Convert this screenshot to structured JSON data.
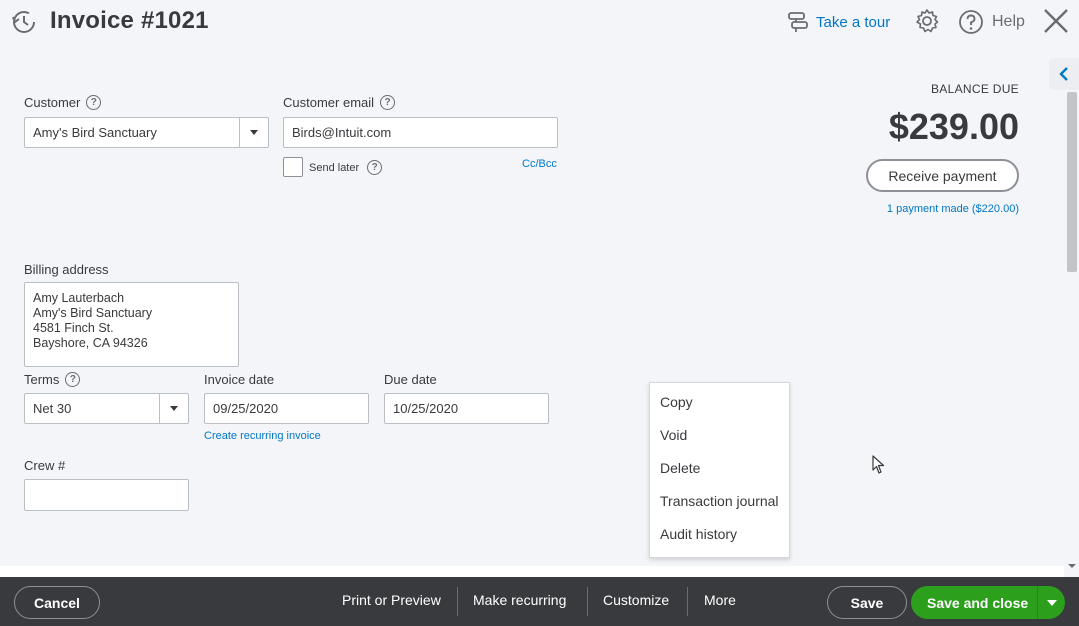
{
  "header": {
    "title": "Invoice #1021",
    "take_tour": "Take a tour",
    "help": "Help"
  },
  "form": {
    "customer_label": "Customer",
    "customer_value": "Amy's Bird Sanctuary",
    "email_label": "Customer email",
    "email_value": "Birds@Intuit.com",
    "send_later": "Send later",
    "cc_bcc": "Cc/Bcc",
    "billing_label": "Billing address",
    "billing_lines": [
      "Amy Lauterbach",
      "Amy's Bird Sanctuary",
      "4581 Finch St.",
      "Bayshore, CA  94326"
    ],
    "terms_label": "Terms",
    "terms_value": "Net 30",
    "invoice_date_label": "Invoice date",
    "invoice_date_value": "09/25/2020",
    "create_recurring": "Create recurring invoice",
    "due_date_label": "Due date",
    "due_date_value": "10/25/2020",
    "crew_label": "Crew #",
    "crew_value": ""
  },
  "balance": {
    "label": "BALANCE DUE",
    "amount": "$239.00",
    "receive_payment": "Receive payment",
    "payments_made": "1 payment made ($220.00)"
  },
  "more_menu": {
    "items": [
      "Copy",
      "Void",
      "Delete",
      "Transaction journal",
      "Audit history"
    ]
  },
  "footer": {
    "cancel": "Cancel",
    "print_preview": "Print or Preview",
    "make_recurring": "Make recurring",
    "customize": "Customize",
    "more": "More",
    "save": "Save",
    "save_close": "Save and close"
  },
  "colors": {
    "accent": "#0077c5",
    "primary_green": "#2ca01c",
    "footer_bg": "#393a3d",
    "page_bg": "#f4f5f8"
  }
}
